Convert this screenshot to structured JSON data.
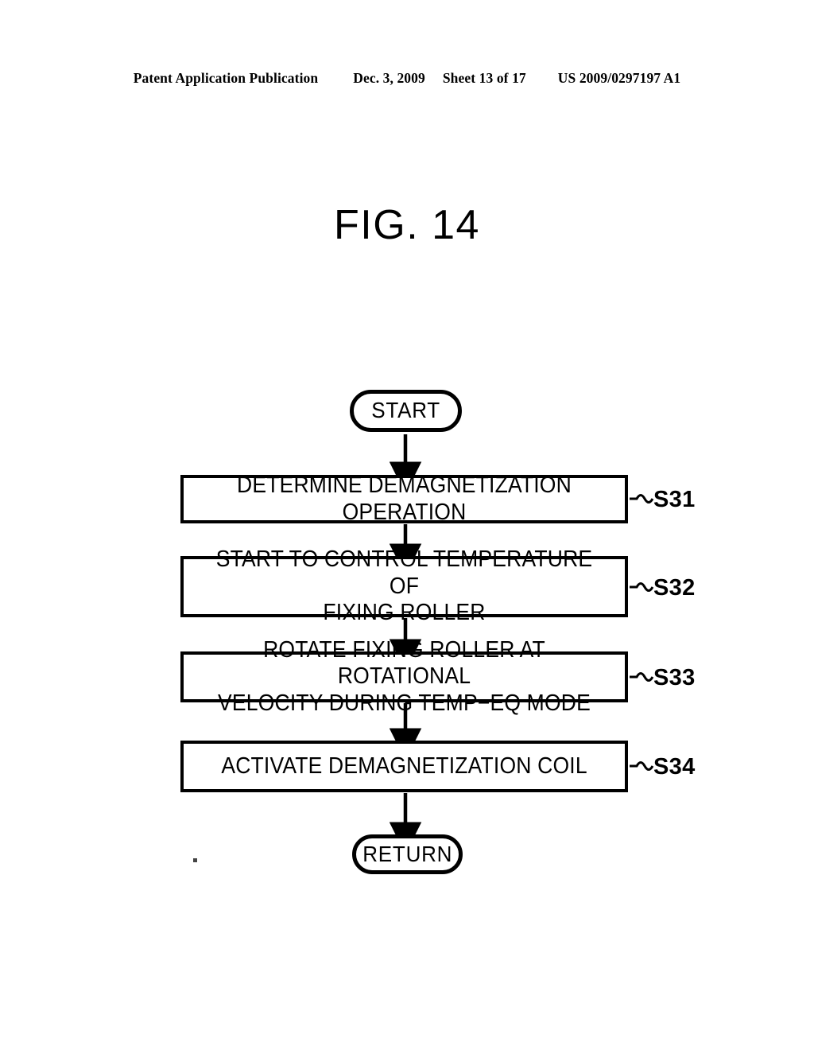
{
  "header": {
    "publication": "Patent Application Publication",
    "date": "Dec. 3, 2009",
    "sheet": "Sheet 13 of 17",
    "patent_number": "US 2009/0297197 A1"
  },
  "figure": {
    "title": "FIG. 14",
    "type": "flowchart",
    "ink_color": "#000000",
    "background_color": "#ffffff"
  },
  "flowchart": {
    "nodes": [
      {
        "id": "start",
        "shape": "terminal",
        "text": "START"
      },
      {
        "id": "s31",
        "shape": "process",
        "text": "DETERMINE DEMAGNETIZATION OPERATION",
        "step": "S31"
      },
      {
        "id": "s32",
        "shape": "process",
        "text": "START TO CONTROL TEMPERATURE OF\nFIXING ROLLER",
        "step": "S32"
      },
      {
        "id": "s33",
        "shape": "process",
        "text": "ROTATE FIXING ROLLER AT ROTATIONAL\nVELOCITY DURING TEMP−EQ MODE",
        "step": "S33"
      },
      {
        "id": "s34",
        "shape": "process",
        "text": "ACTIVATE DEMAGNETIZATION COIL",
        "step": "S34"
      },
      {
        "id": "return",
        "shape": "terminal",
        "text": "RETURN"
      }
    ],
    "step_labels": {
      "s31": "S31",
      "s32": "S32",
      "s33": "S33",
      "s34": "S34"
    },
    "connectors": [
      {
        "from": "start",
        "to": "s31",
        "style": "arrow-down"
      },
      {
        "from": "s31",
        "to": "s32",
        "style": "arrow-down"
      },
      {
        "from": "s32",
        "to": "s33",
        "style": "arrow-down"
      },
      {
        "from": "s33",
        "to": "s34",
        "style": "arrow-down"
      },
      {
        "from": "s34",
        "to": "return",
        "style": "arrow-down"
      }
    ]
  }
}
